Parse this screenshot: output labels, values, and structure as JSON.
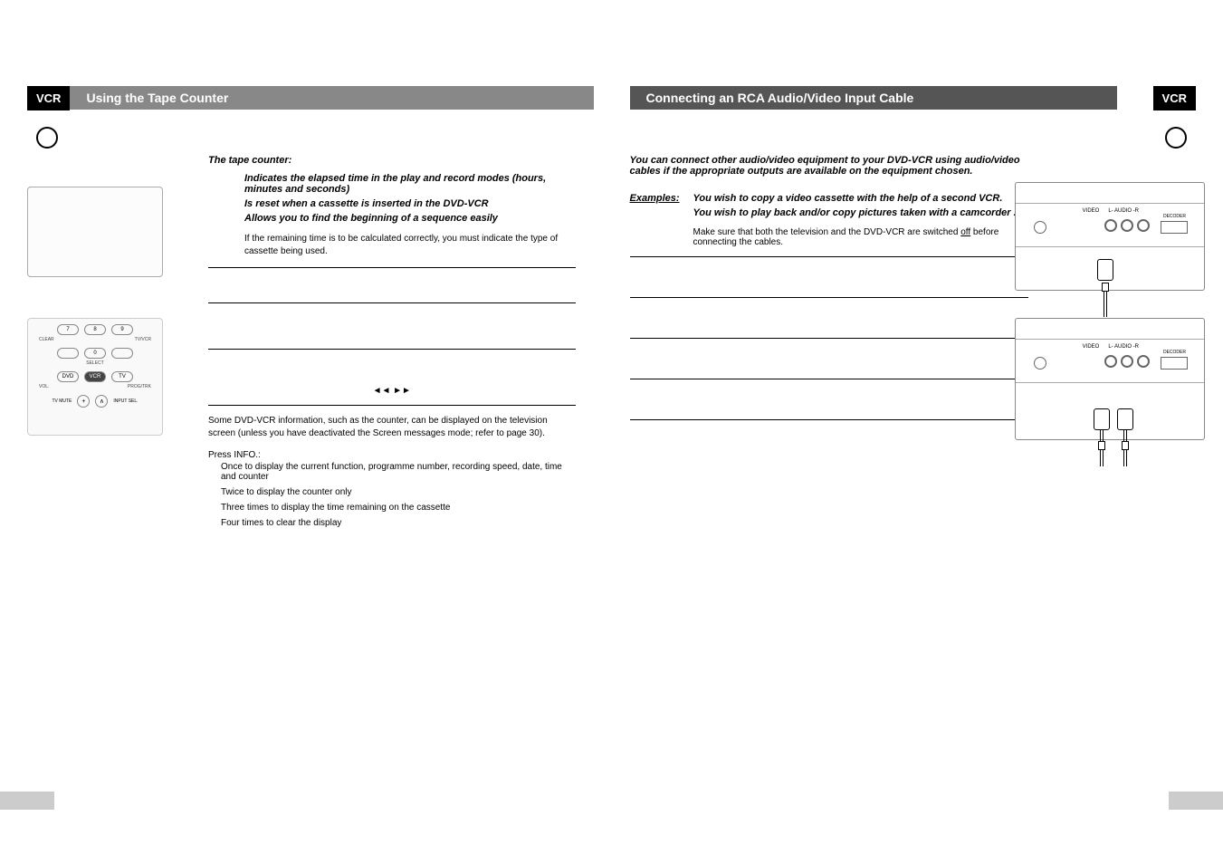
{
  "left": {
    "badge": "VCR",
    "title": "Using the Tape Counter",
    "intro": "The tape counter:",
    "bullets": [
      "Indicates the elapsed time in the play and record modes (hours, minutes and seconds)",
      "Is reset when a cassette is inserted in the DVD-VCR",
      "Allows you to find the beginning of a sequence easily"
    ],
    "note": "If the remaining time is to be calculated correctly, you must indicate the type of cassette being used.",
    "arrows": "◄◄   ►►",
    "counter_info": "Some DVD-VCR information, such as the counter, can be displayed on the television screen (unless you have deactivated the Screen messages mode; refer to page 30).",
    "press_info": "Press INFO.:",
    "info_list": [
      "Once to display the current function, programme number, recording speed, date, time and counter",
      "Twice to display the counter only",
      "Three times to display the time remaining on the cassette",
      "Four times to clear the display"
    ],
    "remote": {
      "row1": [
        "7",
        "8",
        "9"
      ],
      "labels1": [
        "CLEAR",
        "",
        "TV/VCR"
      ],
      "row2_center": "0",
      "labels2": [
        "",
        "SELECT",
        ""
      ],
      "row3": [
        "DVD",
        "VCR",
        "TV"
      ],
      "labels3": [
        "VOL.",
        "",
        "PROG/TRK"
      ],
      "row4": [
        "TV MUTE",
        "+",
        "∧",
        "INPUT SEL."
      ]
    }
  },
  "right": {
    "title": "Connecting an RCA Audio/Video Input Cable",
    "badge": "VCR",
    "intro": "You can connect other audio/video equipment to your DVD-VCR using audio/video cables if the appropriate outputs are available on the equipment chosen.",
    "examples_label": "Examples:",
    "examples": [
      "You wish to copy a video cassette with the help of a second VCR.",
      "You wish to play back and/or copy pictures taken with a camcorder ."
    ],
    "caution": "Make sure that both the television and the DVD-VCR are switched off before connecting the cables.",
    "off_word": "off",
    "device_labels": {
      "video": "VIDEO",
      "audio_l": "L- AUDIO -R",
      "scart": "DECODER"
    }
  }
}
